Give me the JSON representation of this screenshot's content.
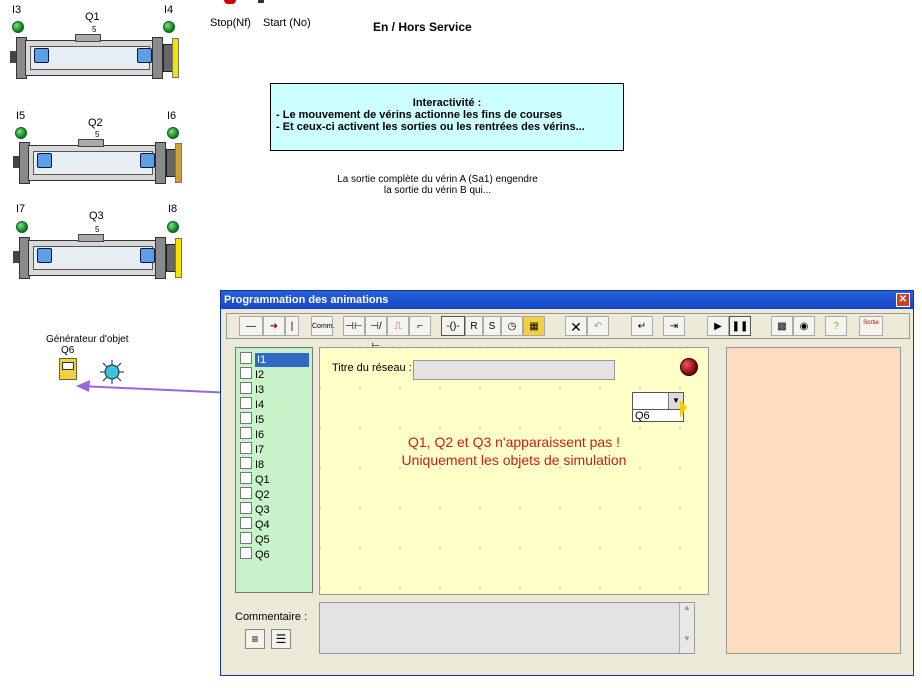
{
  "top": {
    "stop_label": "Stop(Nf)",
    "start_label": "Start (No)",
    "service_label": "En / Hors Service"
  },
  "cylinders": [
    {
      "left_sensor": "I3",
      "right_sensor": "I4",
      "name": "Q1"
    },
    {
      "left_sensor": "I5",
      "right_sensor": "I6",
      "name": "Q2"
    },
    {
      "left_sensor": "I7",
      "right_sensor": "I8",
      "name": "Q3"
    }
  ],
  "valve_marker": "5",
  "info_box": {
    "title": "Interactivité :",
    "line1": "- Le mouvement de vérins actionne les fins de courses",
    "line2": "- Et ceux-ci activent les sorties ou les rentrées des vérins..."
  },
  "note": {
    "line1": "La sortie complète du vérin A (Sa1) engendre",
    "line2": "la sortie du vérin B  qui..."
  },
  "generator": {
    "title": "Générateur d'objet",
    "name": "Q6"
  },
  "window": {
    "title": "Programmation des animations",
    "close_symbol": "✕",
    "toolbar": {
      "comm": "Comm.",
      "r": "R",
      "s": "S",
      "sortie": "Sortie"
    },
    "list_items": [
      "I1",
      "I2",
      "I3",
      "I4",
      "I5",
      "I6",
      "I7",
      "I8",
      "Q1",
      "Q2",
      "Q3",
      "Q4",
      "Q5",
      "Q6"
    ],
    "network_title_label": "Titre du réseau :",
    "network_title_value": "",
    "combo_value": "",
    "dropdown_option": "Q6",
    "annotation_line1": "Q1, Q2 et Q3 n'apparaissent pas !",
    "annotation_line2": "Uniquement les objets de simulation",
    "comment_label": "Commentaire :",
    "comment_value": ""
  },
  "colors": {
    "title_bar": "#1547c7",
    "list_bg": "#c8f3c8",
    "canvas_bg": "#ffffc8",
    "right_panel_bg": "#fddcc0",
    "annotation_text": "#c81e14",
    "info_bg": "#ccffff",
    "arrow": "#9966dd"
  }
}
